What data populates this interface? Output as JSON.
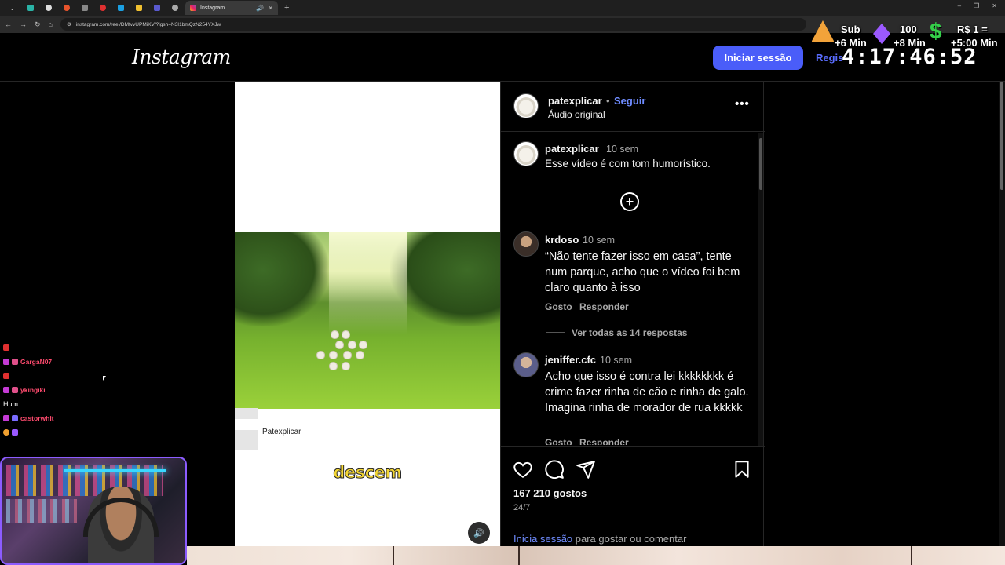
{
  "browser": {
    "active_tab_title": "Instagram",
    "url": "instagram.com/reel/DMfvvUPMiKV/?igsh=N3I1bmQzN254YXJw"
  },
  "header": {
    "logo": "Instagram",
    "login_button": "Iniciar sessão",
    "register_link": "Regis"
  },
  "stream_overlay": {
    "sub_label": "Sub",
    "sub_value": "+6 Min",
    "hundred_label": "100",
    "hundred_value": "+8 Min",
    "rs_label": "R$ 1 =",
    "rs_value": "+5:00 Min",
    "timer": "4:17:46:52"
  },
  "reel": {
    "credit": "Patexplicar",
    "subtitle": "descem"
  },
  "post": {
    "author": "patexplicar",
    "separator": "•",
    "follow": "Seguir",
    "audio": "Áudio original",
    "caption": {
      "user": "patexplicar",
      "time": "10 sem",
      "text": "Esse vídeo é com tom humorístico."
    },
    "comments": [
      {
        "user": "krdoso",
        "time": "10 sem",
        "text": "“Não tente fazer isso em casa”, tente num parque, acho que o vídeo foi bem claro quanto à isso",
        "like": "Gosto",
        "reply": "Responder",
        "view_replies": "Ver todas as 14 respostas"
      },
      {
        "user": "jeniffer.cfc",
        "time": "10 sem",
        "text": "Acho que isso é contra lei kkkkkkkk é crime fazer rinha de cão e rinha de galo. Imagina rinha de morador de rua kkkkk",
        "like": "Gosto",
        "reply": "Responder"
      }
    ],
    "likes": "167 210 gostos",
    "date": "24/7",
    "login_prompt_link": "Inicia sessão",
    "login_prompt_text": " para gostar ou comentar"
  },
  "chat": [
    {
      "name": "GargaN07",
      "message": ""
    },
    {
      "name": "ykingiki",
      "message": "Hum"
    },
    {
      "name": "castorwhit",
      "message": ""
    }
  ],
  "colors": {
    "accent": "#4a5df9",
    "link": "#6f8cff",
    "background": "#000000"
  }
}
